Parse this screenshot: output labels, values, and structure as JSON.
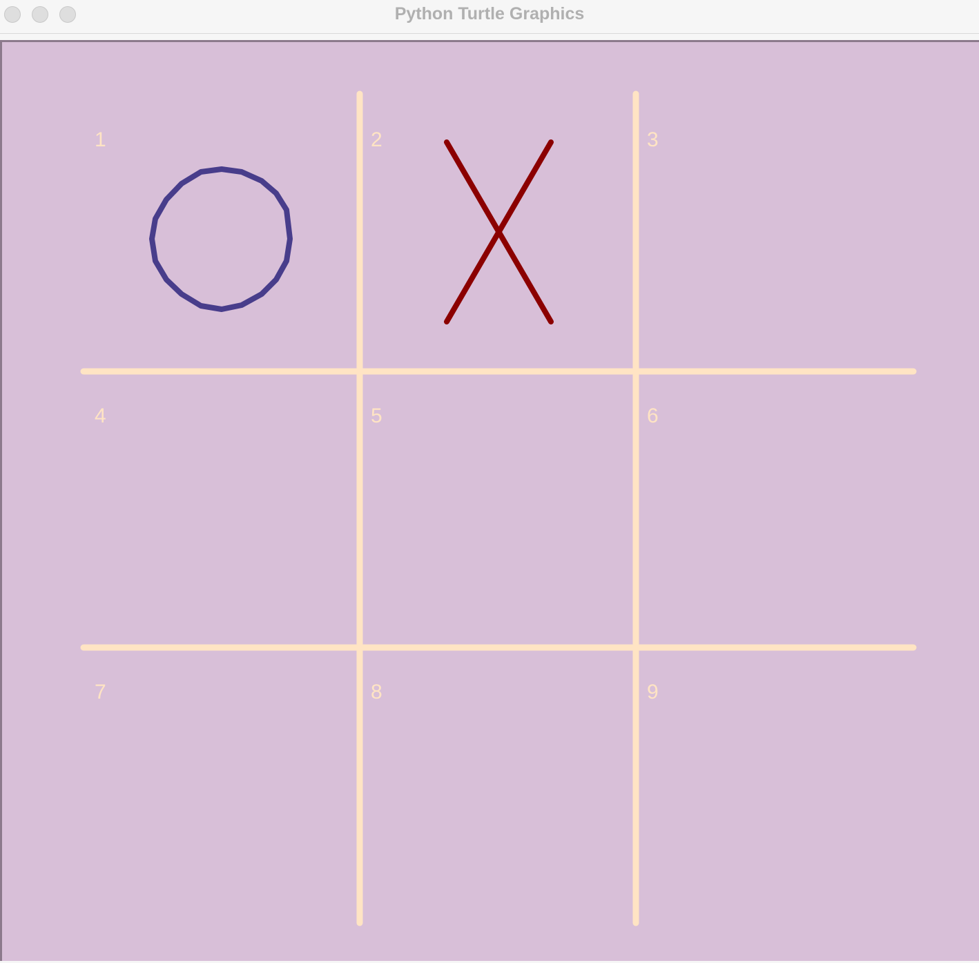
{
  "window": {
    "title": "Python Turtle Graphics"
  },
  "board": {
    "background_color": "#d8bfd8",
    "line_color": "#ffe4c4",
    "cell_labels": [
      "1",
      "2",
      "3",
      "4",
      "5",
      "6",
      "7",
      "8",
      "9"
    ],
    "marks": [
      {
        "cell": "1",
        "symbol": "O",
        "color": "#483d8b"
      },
      {
        "cell": "2",
        "symbol": "X",
        "color": "#8b0000"
      }
    ]
  }
}
